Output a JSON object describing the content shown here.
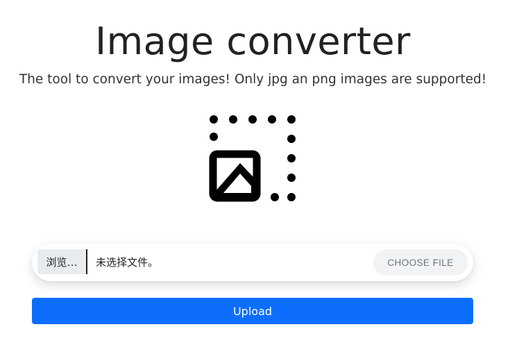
{
  "header": {
    "title": "Image converter",
    "subtitle": "The tool to convert your images! Only jpg an png images are supported!"
  },
  "dropzone": {
    "icon": "image-upload-icon"
  },
  "file_input": {
    "browse_label": "浏览…",
    "status": "未选择文件。",
    "choose_label": "CHOOSE FILE"
  },
  "upload": {
    "label": "Upload"
  },
  "colors": {
    "accent": "#0d6efd",
    "icon": "#000000"
  }
}
